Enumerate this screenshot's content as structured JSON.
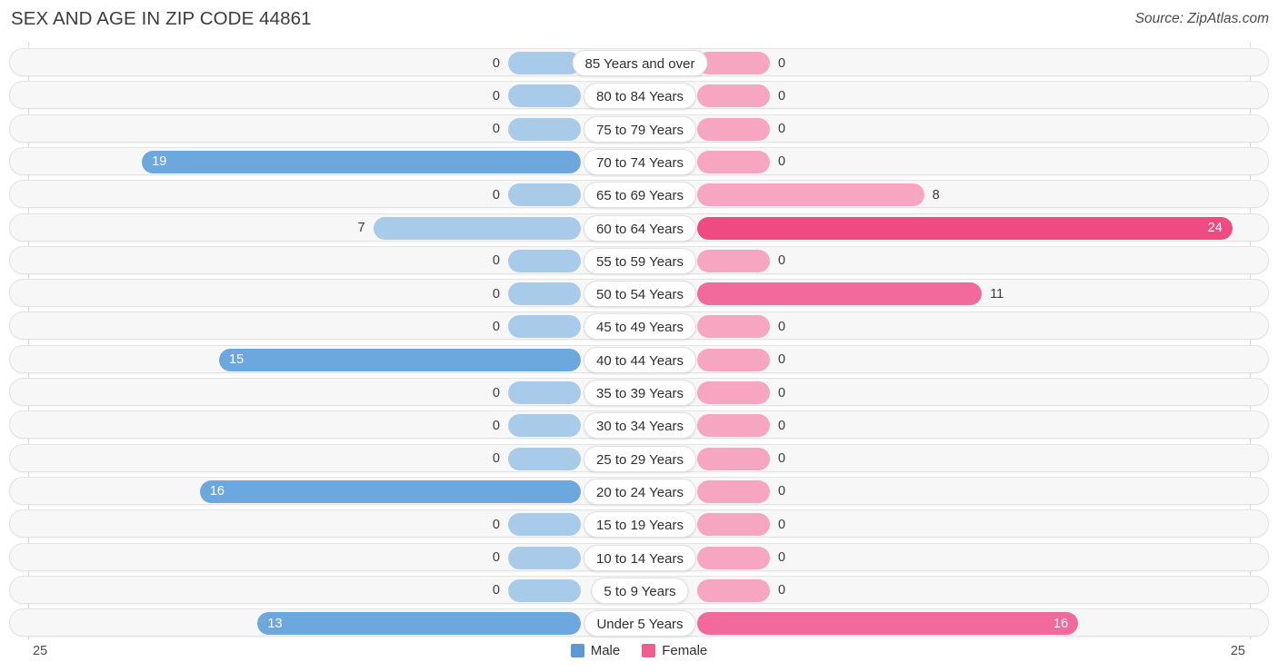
{
  "header": {
    "title": "SEX AND AGE IN ZIP CODE 44861",
    "source": "Source: ZipAtlas.com"
  },
  "axis": {
    "left_end": "25",
    "right_end": "25",
    "max": 25
  },
  "legend": [
    {
      "label": "Male",
      "color": "#5b9bd5"
    },
    {
      "label": "Female",
      "color": "#ee5f8f"
    }
  ],
  "colors": {
    "male_strong": "#4a90d9",
    "male_mid": "#6ca8de",
    "male_pale": "#a8cbea",
    "female_strong": "#ef4a81",
    "female_mid": "#f2699b",
    "female_pale": "#f6a6c1",
    "track": "#f7f7f7",
    "track_border": "#e3e3e3",
    "axis_line": "#dadada"
  },
  "chart_data": {
    "type": "bar",
    "subtype": "diverging-population-pyramid",
    "title": "SEX AND AGE IN ZIP CODE 44861",
    "xlabel": "",
    "ylabel": "",
    "xlim": [
      25,
      25
    ],
    "grid": false,
    "legend_position": "bottom-center",
    "categories": [
      "85 Years and over",
      "80 to 84 Years",
      "75 to 79 Years",
      "70 to 74 Years",
      "65 to 69 Years",
      "60 to 64 Years",
      "55 to 59 Years",
      "50 to 54 Years",
      "45 to 49 Years",
      "40 to 44 Years",
      "35 to 39 Years",
      "30 to 34 Years",
      "25 to 29 Years",
      "20 to 24 Years",
      "15 to 19 Years",
      "10 to 14 Years",
      "5 to 9 Years",
      "Under 5 Years"
    ],
    "series": [
      {
        "name": "Male",
        "color": "#5b9bd5",
        "direction": "left",
        "values": [
          0,
          0,
          0,
          19,
          0,
          7,
          0,
          0,
          0,
          15,
          0,
          0,
          0,
          16,
          0,
          0,
          0,
          13
        ]
      },
      {
        "name": "Female",
        "color": "#ee5f8f",
        "direction": "right",
        "values": [
          0,
          0,
          0,
          0,
          8,
          24,
          0,
          11,
          0,
          0,
          0,
          0,
          0,
          0,
          0,
          0,
          0,
          16
        ]
      }
    ]
  }
}
